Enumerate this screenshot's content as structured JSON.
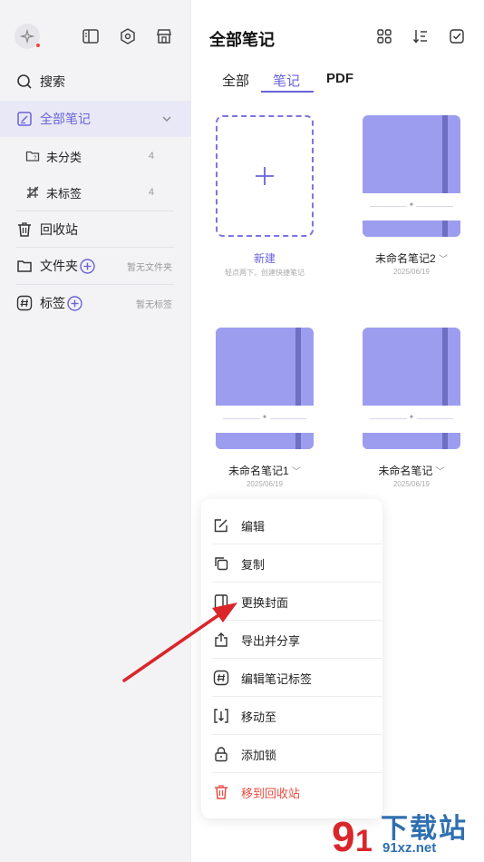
{
  "sidebar": {
    "search_label": "搜索",
    "all_notes_label": "全部笔记",
    "uncategorized_label": "未分类",
    "uncategorized_count": "4",
    "untagged_label": "未标签",
    "untagged_count": "4",
    "recycle_label": "回收站",
    "folders_label": "文件夹",
    "folders_hint": "暂无文件夹",
    "tags_label": "标签",
    "tags_hint": "暂无标签"
  },
  "header": {
    "title": "全部笔记"
  },
  "tabs": [
    {
      "label": "全部"
    },
    {
      "label": "笔记"
    },
    {
      "label": "PDF"
    }
  ],
  "cards": {
    "new_label": "新建",
    "new_hint": "轻点两下，创建快捷笔记",
    "note2_name": "未命名笔记2",
    "note2_date": "2025/06/19",
    "note1_name": "未命名笔记1",
    "note1_date": "2025/06/19",
    "note0_name": "未命名笔记",
    "note0_date": "2025/06/19"
  },
  "context_menu": {
    "edit": "编辑",
    "copy": "复制",
    "change_cover": "更换封面",
    "export_share": "导出并分享",
    "edit_tags": "编辑笔记标签",
    "move_to": "移动至",
    "add_lock": "添加锁",
    "move_to_trash": "移到回收站"
  },
  "watermark": {
    "brand": "下载站",
    "url": "91xz.net"
  },
  "colors": {
    "accent": "#6a63d8",
    "notebook": "#9d9df0",
    "strap": "#6d6fc2",
    "danger": "#e84c42",
    "arrow": "#d9262b"
  }
}
